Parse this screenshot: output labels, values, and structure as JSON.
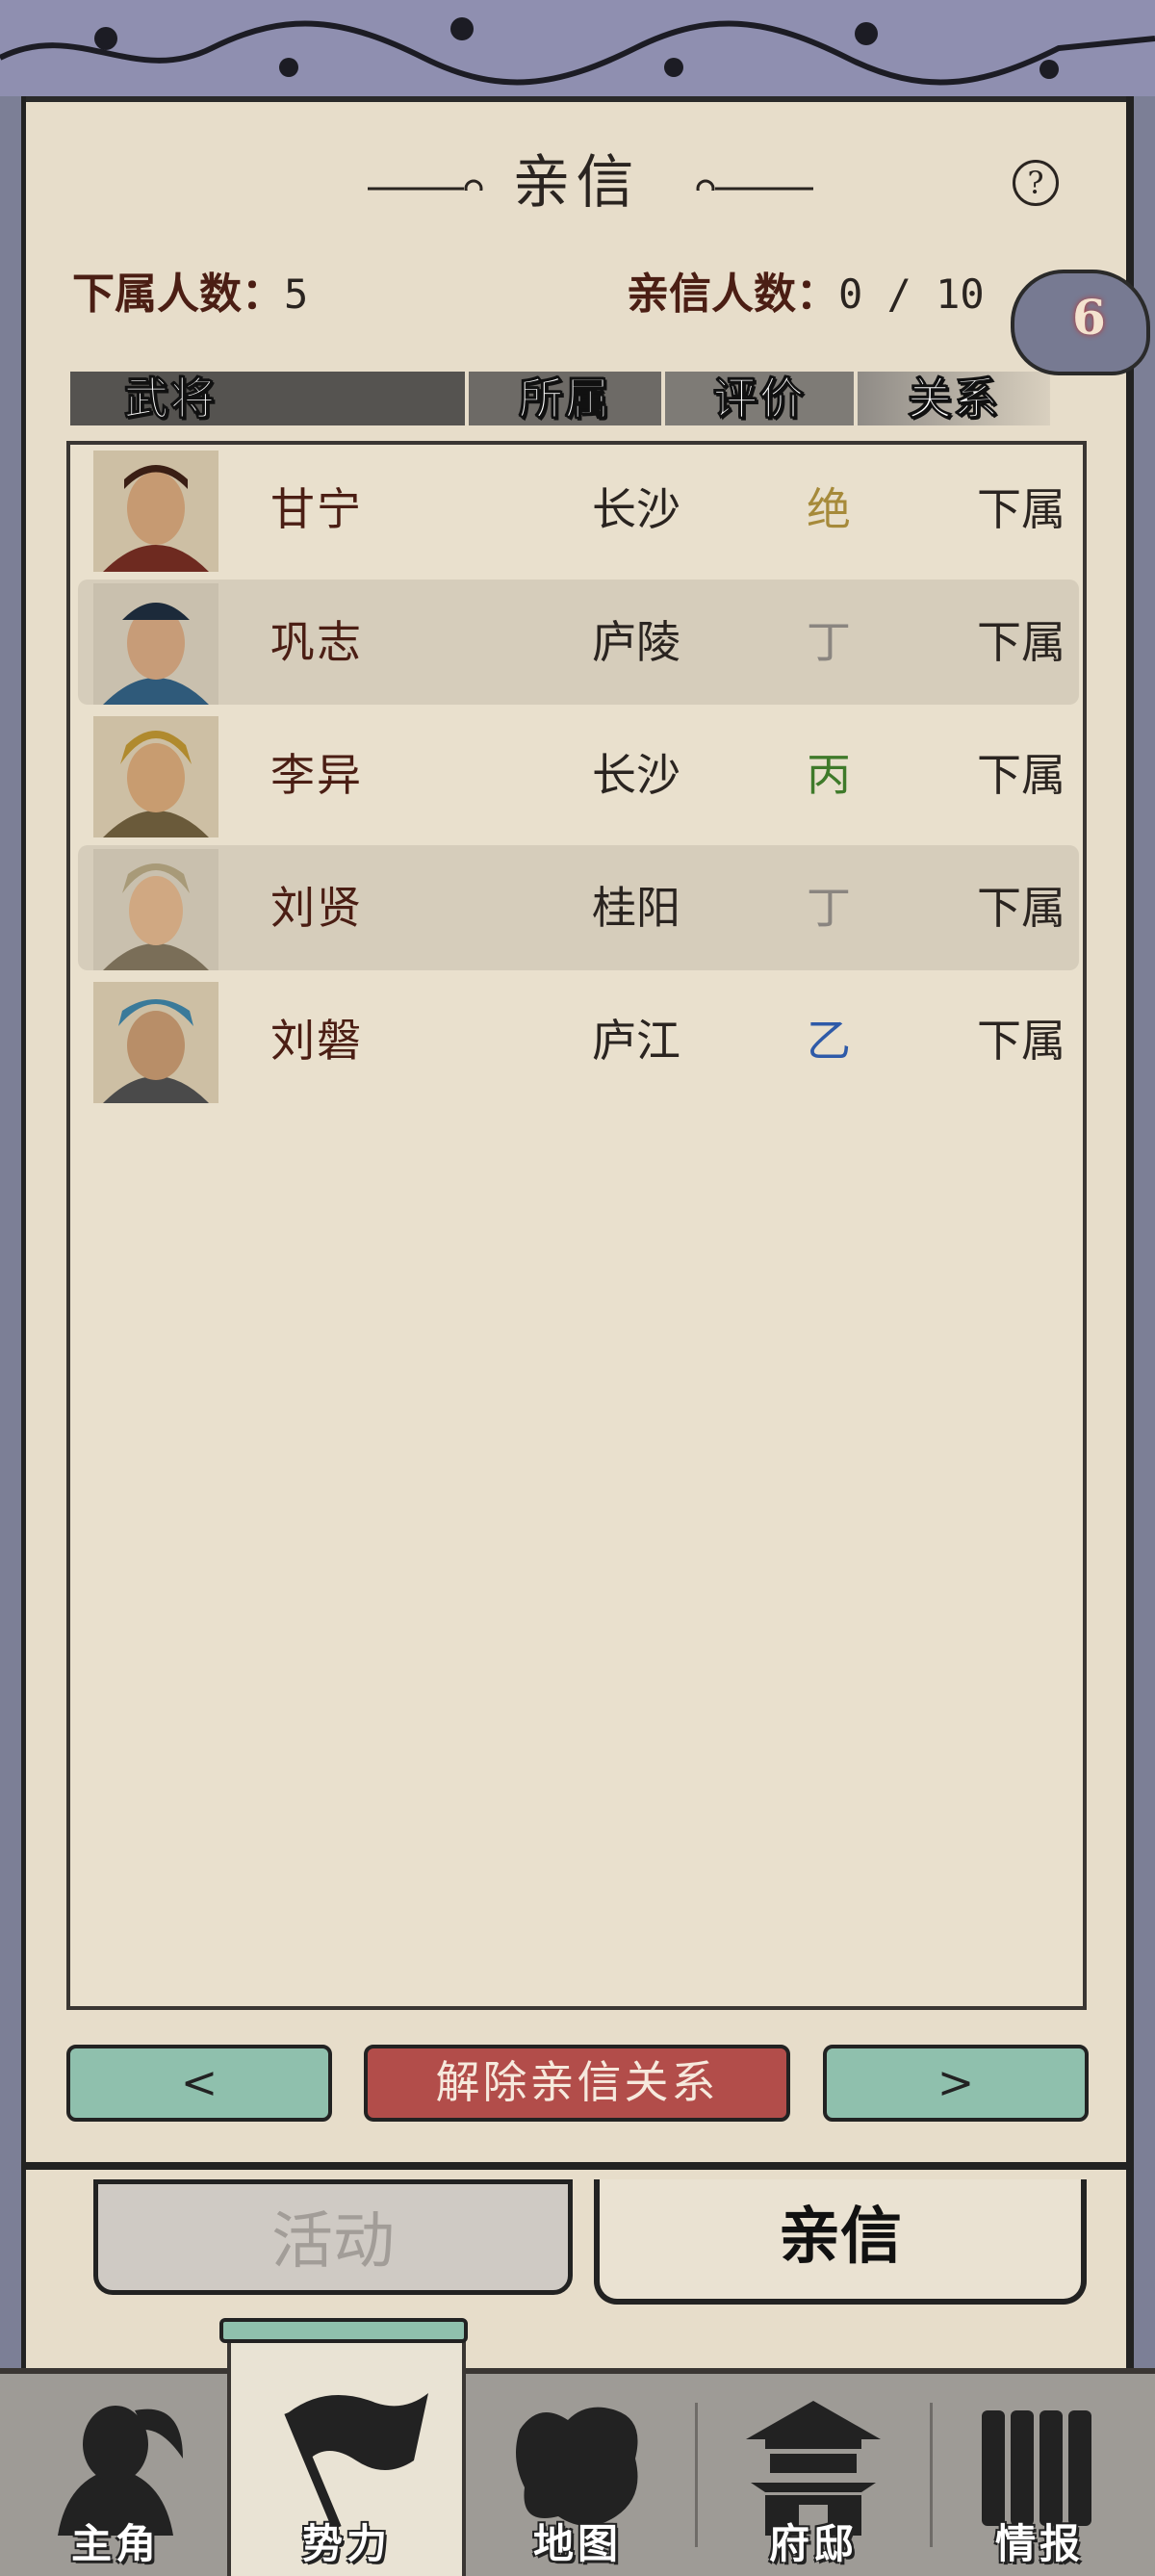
{
  "header": {
    "title": "亲信",
    "help_icon": "help-icon"
  },
  "stats": {
    "subordinates_label": "下属人数：",
    "subordinates_value": "5",
    "trusted_label": "亲信人数：",
    "trusted_value": "0 / 10"
  },
  "badge": {
    "count": "6"
  },
  "table": {
    "headers": [
      "武将",
      "所属",
      "评价",
      "关系"
    ],
    "rows": [
      {
        "name": "甘宁",
        "faction": "长沙",
        "rating": "绝",
        "rating_color": "#a68a3a",
        "relation": "下属",
        "portrait_color": "#6e2a20"
      },
      {
        "name": "巩志",
        "faction": "庐陵",
        "rating": "丁",
        "rating_color": "#8a8580",
        "relation": "下属",
        "portrait_color": "#2f5a7a"
      },
      {
        "name": "李异",
        "faction": "长沙",
        "rating": "丙",
        "rating_color": "#3f7a2a",
        "relation": "下属",
        "portrait_color": "#b08a2e"
      },
      {
        "name": "刘贤",
        "faction": "桂阳",
        "rating": "丁",
        "rating_color": "#8a8580",
        "relation": "下属",
        "portrait_color": "#a89a78"
      },
      {
        "name": "刘磐",
        "faction": "庐江",
        "rating": "乙",
        "rating_color": "#2e5aa8",
        "relation": "下属",
        "portrait_color": "#3a7a9a"
      }
    ]
  },
  "buttons": {
    "prev": "<",
    "dismiss": "解除亲信关系",
    "next": ">"
  },
  "subtabs": {
    "activity": "活动",
    "trusted": "亲信",
    "active": "trusted"
  },
  "bottom_nav": {
    "items": [
      {
        "label": "主角",
        "icon": "hero-icon"
      },
      {
        "label": "势力",
        "icon": "flag-icon"
      },
      {
        "label": "地图",
        "icon": "map-icon"
      },
      {
        "label": "府邸",
        "icon": "mansion-icon"
      },
      {
        "label": "情报",
        "icon": "scroll-icon"
      }
    ],
    "active_index": 1
  },
  "colors": {
    "panel_bg": "#e7ddca",
    "frame": "#7c7f96",
    "name_text": "#4b1e14",
    "button_green": "#8fc0ad",
    "button_red": "#b24d4a"
  }
}
